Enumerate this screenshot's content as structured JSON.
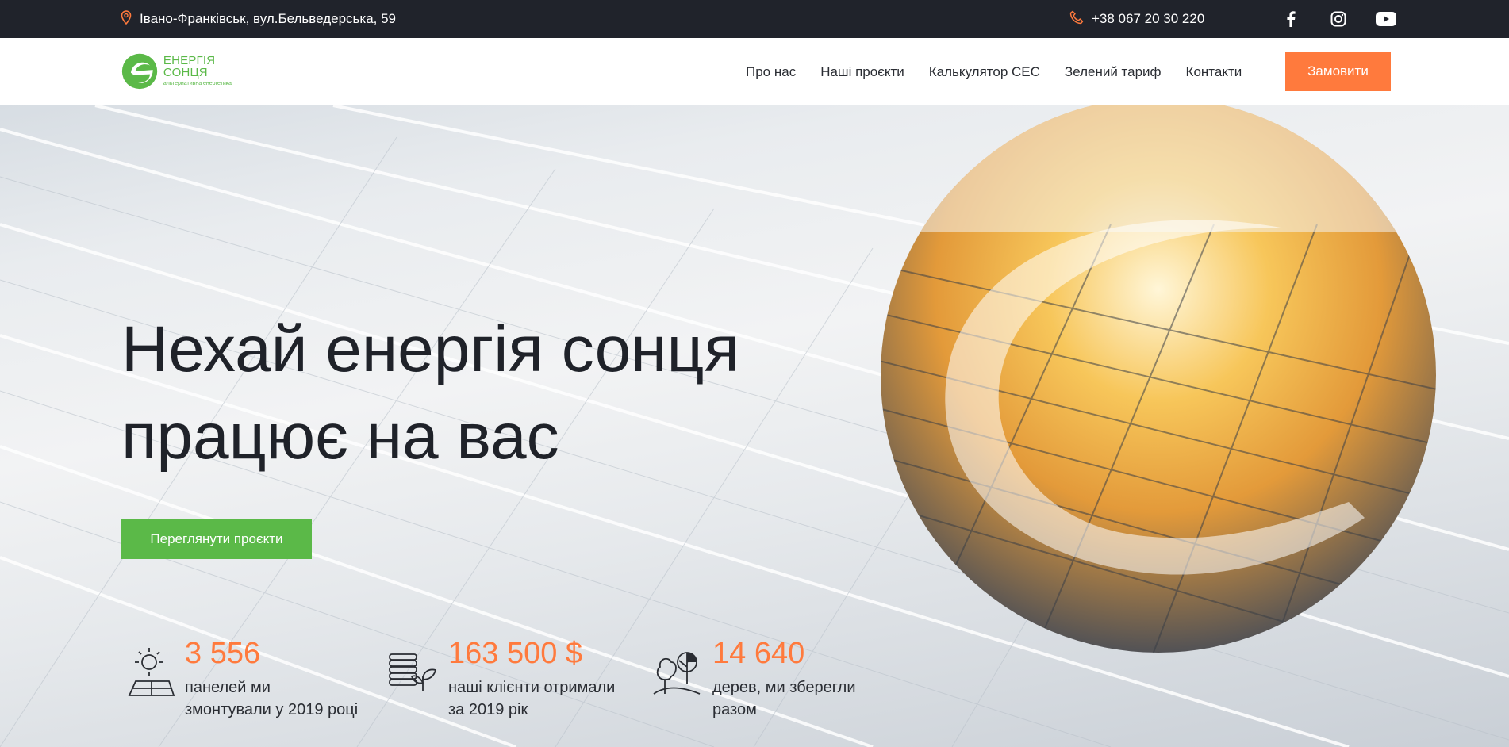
{
  "topbar": {
    "address": "Івано-Франківськ, вул.Бельведерська, 59",
    "phone": "+38 067 20 30 220",
    "social": [
      {
        "icon": "facebook-icon"
      },
      {
        "icon": "instagram-icon"
      },
      {
        "icon": "youtube-icon"
      }
    ]
  },
  "header": {
    "logo_name": "ЕНЕРГІЯ СОНЦЯ",
    "logo_sub": "альтернативна енергетика",
    "nav": [
      "Про нас",
      "Наші проєкти",
      "Калькулятор СЕС",
      "Зелений тариф",
      "Контакти"
    ],
    "order_label": "Замовити"
  },
  "hero": {
    "title_line1": "Нехай енергія сонця",
    "title_line2": "працює на вас",
    "cta_label": "Переглянути проєкти"
  },
  "stats": [
    {
      "number": "3 556",
      "desc_line1": "панелей ми",
      "desc_line2": "змонтували у 2019 році",
      "icon": "solar-panel-icon"
    },
    {
      "number": "163 500 $",
      "desc_line1": "наші клієнти отримали",
      "desc_line2": "за 2019 рік",
      "icon": "coins-growth-icon"
    },
    {
      "number": "14 640",
      "desc_line1": "дерев, ми зберегли",
      "desc_line2": "разом",
      "icon": "trees-icon"
    }
  ],
  "colors": {
    "accent_orange": "#ff7a3d",
    "brand_green": "#5bb948",
    "topbar_bg": "#20232b",
    "text_dark": "#1f2229"
  }
}
